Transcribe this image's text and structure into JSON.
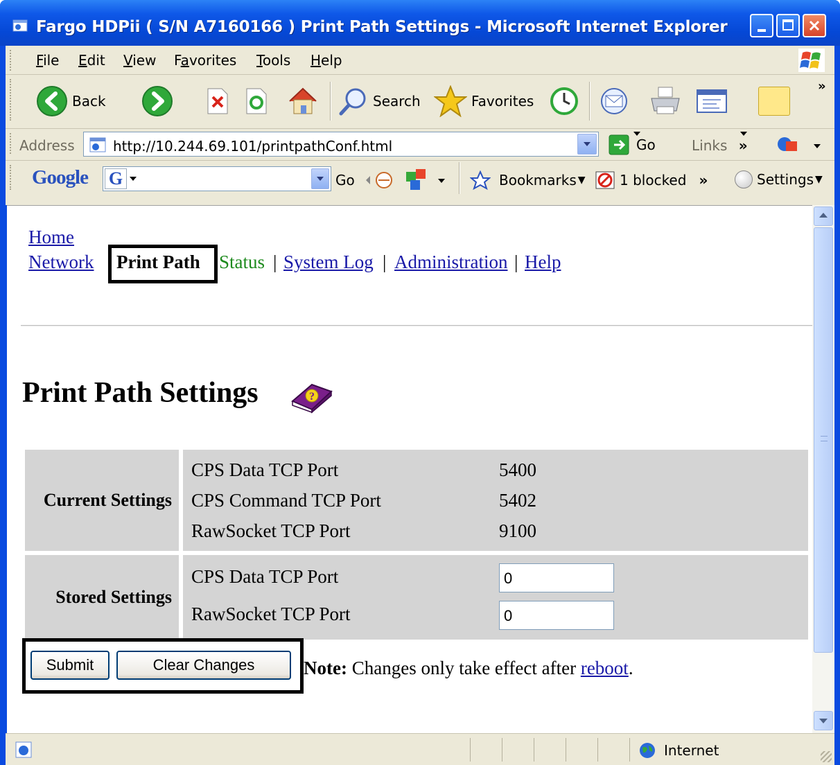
{
  "window": {
    "title": "Fargo HDPii ( S/N A7160166 ) Print Path Settings - Microsoft Internet Explorer"
  },
  "menu": {
    "file": "File",
    "edit": "Edit",
    "view": "View",
    "favorites": "Favorites",
    "tools": "Tools",
    "help": "Help"
  },
  "toolbar": {
    "back": "Back",
    "search": "Search",
    "favorites": "Favorites"
  },
  "address": {
    "label": "Address",
    "url": "http://10.244.69.101/printpathConf.html",
    "go": "Go",
    "links": "Links"
  },
  "googlebar": {
    "logo": "Google",
    "go": "Go",
    "bookmarks": "Bookmarks",
    "blocked": "1 blocked",
    "settings": "Settings"
  },
  "nav": {
    "home": "Home",
    "network": "Network",
    "print_path": "Print Path",
    "status": "Status",
    "system_log": "System Log",
    "administration": "Administration",
    "help": "Help",
    "separator": "|"
  },
  "page": {
    "heading": "Print Path Settings"
  },
  "current_settings": {
    "label": "Current Settings",
    "rows": [
      {
        "name": "CPS Data TCP Port",
        "value": "5400"
      },
      {
        "name": "CPS Command TCP Port",
        "value": "5402"
      },
      {
        "name": "RawSocket TCP Port",
        "value": "9100"
      }
    ]
  },
  "stored_settings": {
    "label": "Stored Settings",
    "rows": [
      {
        "name": "CPS Data TCP Port",
        "value": "0"
      },
      {
        "name": "RawSocket TCP Port",
        "value": "0"
      }
    ]
  },
  "actions": {
    "submit": "Submit",
    "clear": "Clear Changes"
  },
  "note": {
    "label": "Note:",
    "text": "Changes only take effect after",
    "link": "reboot",
    "period": "."
  },
  "statusbar": {
    "zone": "Internet"
  },
  "colors": {
    "titlebar": "#0548d6",
    "link": "#1a1aa8",
    "status_link": "#1d8a1d",
    "table_bg": "#d4d4d4"
  }
}
